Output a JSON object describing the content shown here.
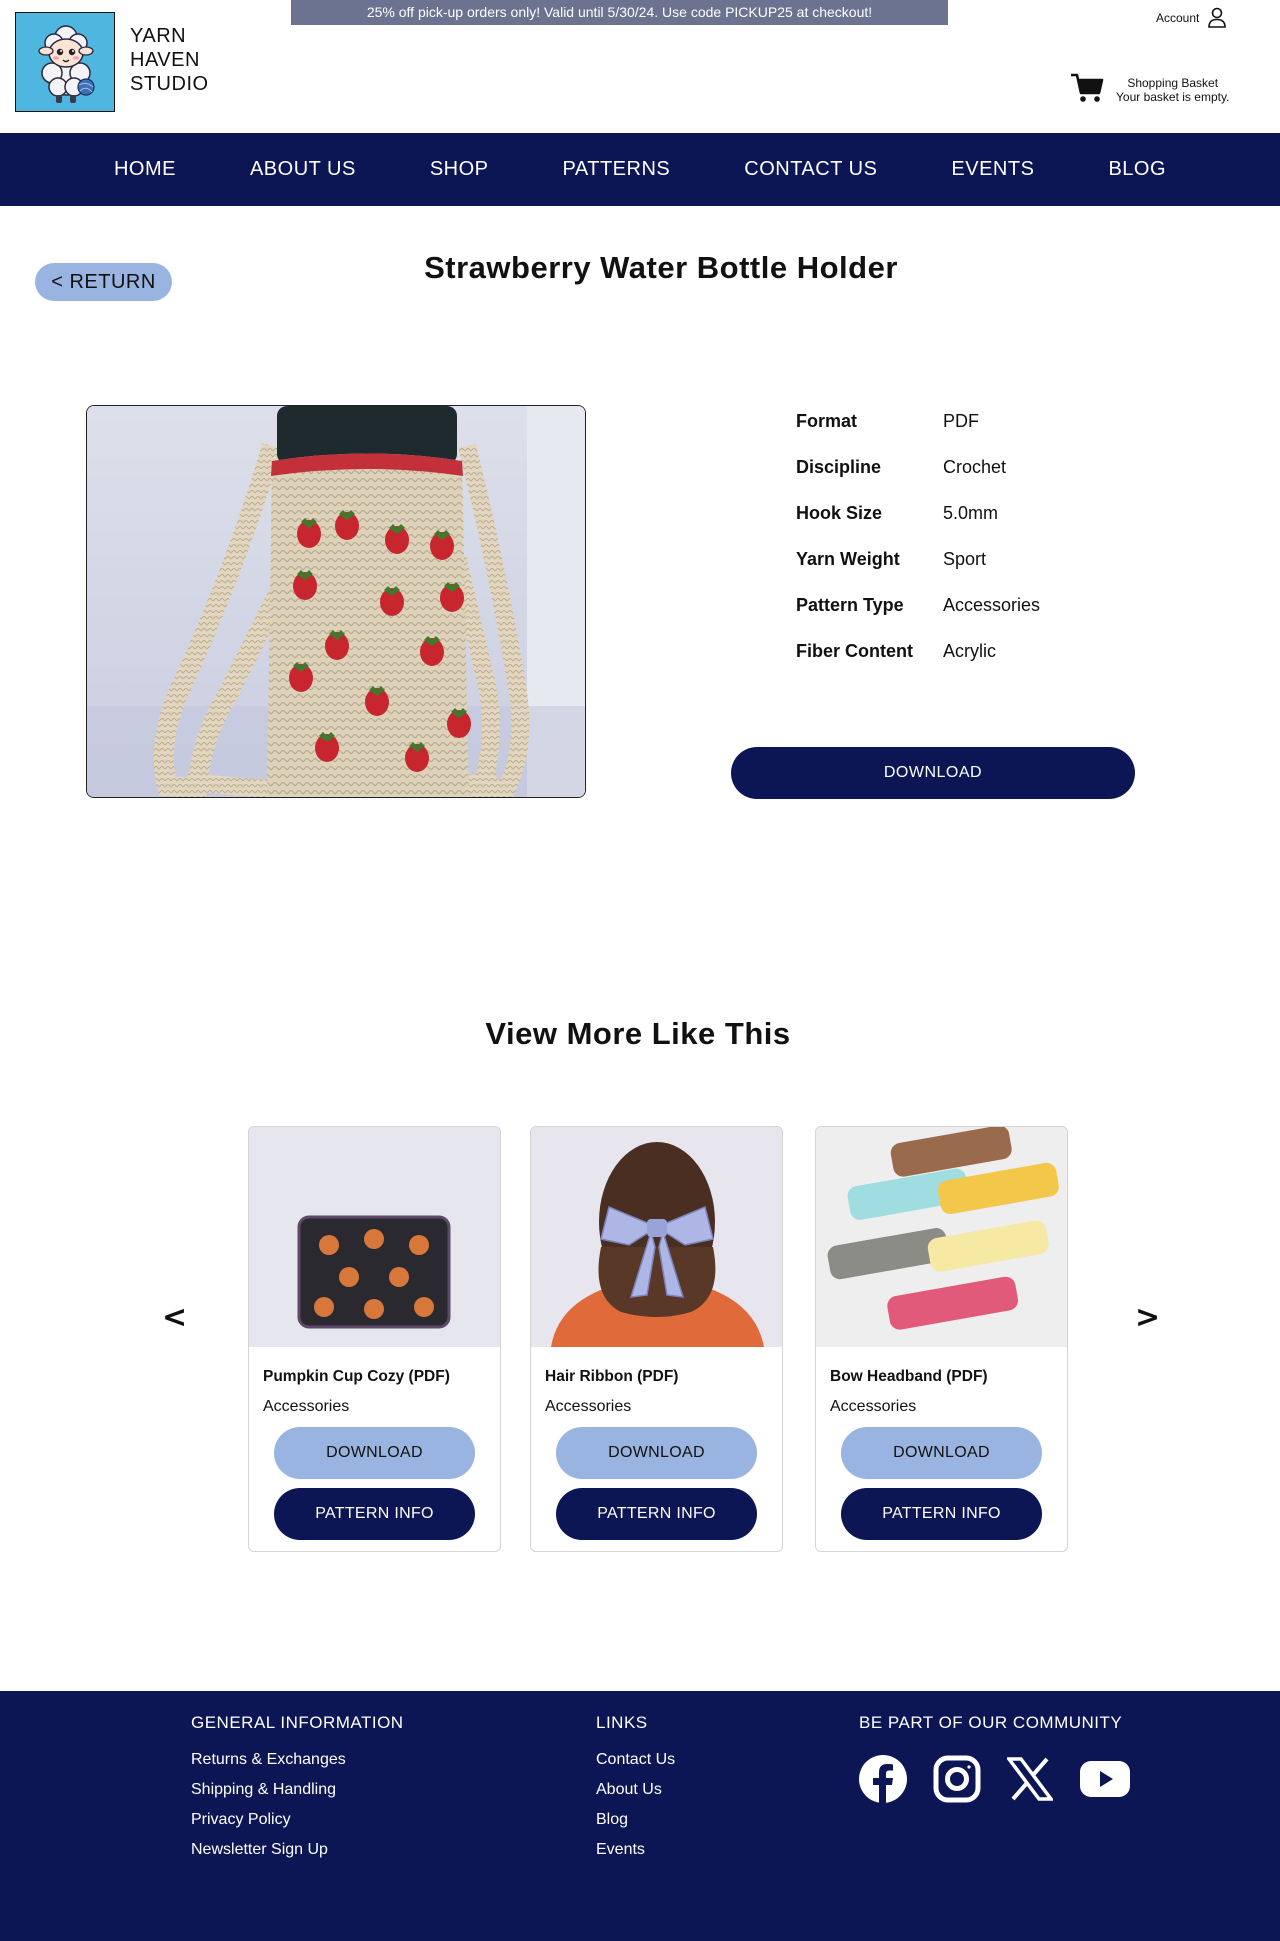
{
  "header": {
    "brand_lines": [
      "YARN",
      "HAVEN",
      "STUDIO"
    ],
    "promo": "25% off pick-up orders only! Valid until 5/30/24. Use code PICKUP25 at checkout!",
    "account_label": "Account",
    "basket_title": "Shopping Basket",
    "basket_status": "Your basket is empty."
  },
  "nav": {
    "items": [
      "HOME",
      "ABOUT US",
      "SHOP",
      "PATTERNS",
      "CONTACT US",
      "EVENTS",
      "BLOG"
    ]
  },
  "product": {
    "return_label": "< RETURN",
    "title": "Strawberry Water Bottle Holder",
    "specs": [
      {
        "key": "Format",
        "value": "PDF"
      },
      {
        "key": "Discipline",
        "value": "Crochet"
      },
      {
        "key": "Hook Size",
        "value": "5.0mm"
      },
      {
        "key": "Yarn Weight",
        "value": "Sport"
      },
      {
        "key": "Pattern Type",
        "value": "Accessories"
      },
      {
        "key": "Fiber Content",
        "value": "Acrylic"
      }
    ],
    "download_label": "DOWNLOAD"
  },
  "related": {
    "title": "View More Like This",
    "prev_label": "<",
    "next_label": ">",
    "cards": [
      {
        "name": "Pumpkin Cup Cozy (PDF)",
        "category": "Accessories",
        "download_label": "DOWNLOAD",
        "info_label": "PATTERN INFO"
      },
      {
        "name": "Hair Ribbon (PDF)",
        "category": "Accessories",
        "download_label": "DOWNLOAD",
        "info_label": "PATTERN INFO"
      },
      {
        "name": "Bow Headband (PDF)",
        "category": "Accessories",
        "download_label": "DOWNLOAD",
        "info_label": "PATTERN INFO"
      }
    ]
  },
  "footer": {
    "general": {
      "heading": "GENERAL INFORMATION",
      "links": [
        "Returns & Exchanges",
        "Shipping & Handling",
        "Privacy Policy",
        "Newsletter Sign Up"
      ]
    },
    "links": {
      "heading": "LINKS",
      "links": [
        "Contact Us",
        "About Us",
        "Blog",
        "Events"
      ]
    },
    "community": {
      "heading": "BE PART OF OUR COMMUNITY",
      "icons": [
        "facebook-icon",
        "instagram-icon",
        "x-icon",
        "youtube-icon"
      ]
    }
  },
  "colors": {
    "navy": "#0c1654",
    "light_blue": "#9ab4e2",
    "promo_bg": "#6b7390",
    "logo_bg": "#4fb6e0"
  }
}
